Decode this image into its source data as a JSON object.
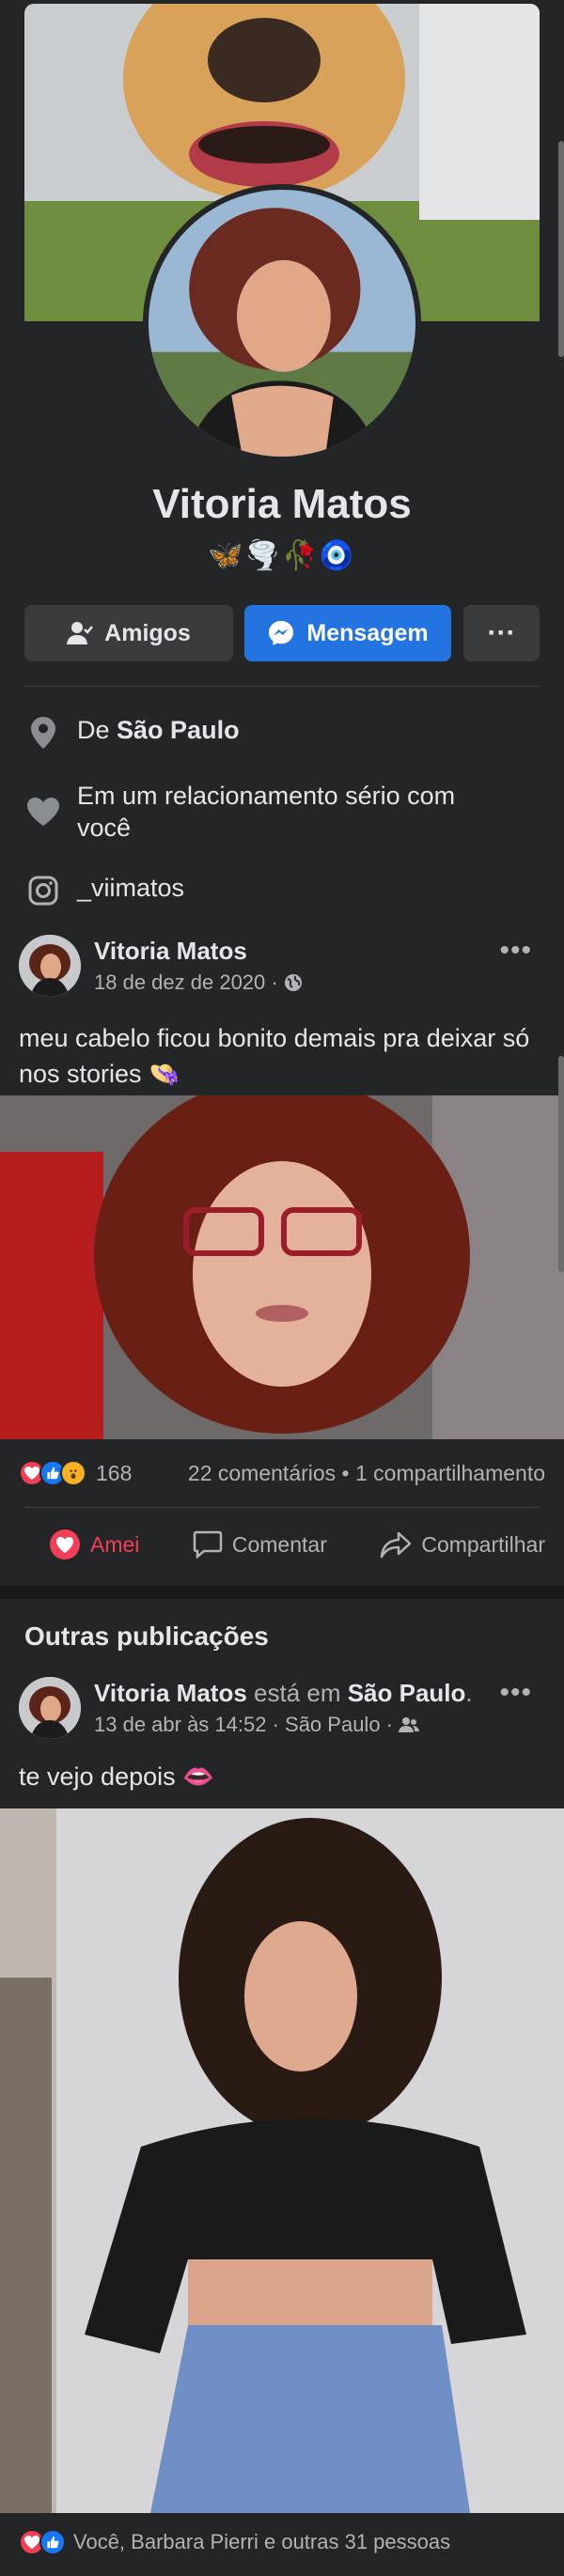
{
  "profile": {
    "name": "Vitoria Matos",
    "bio": "🦋🌪️🥀🧿"
  },
  "actions": {
    "friends_label": "Amigos",
    "message_label": "Mensagem",
    "more_label": "···"
  },
  "intro": {
    "from_prefix": "De ",
    "from_city": "São Paulo",
    "relationship": "Em um relacionamento sério com você",
    "instagram": "_viimatos"
  },
  "post1": {
    "author": "Vitoria Matos",
    "date": "18 de dez de 2020 · ",
    "privacy_icon": "globe-icon",
    "text": "meu cabelo ficou bonito demais pra deixar só nos stories 👒",
    "reaction_count": "168",
    "comments_shares": "22 comentários • 1 compartilhamento",
    "love_label": "Amei",
    "comment_label": "Comentar",
    "share_label": "Compartilhar"
  },
  "others": {
    "title": "Outras publicações"
  },
  "post2": {
    "author": "Vitoria Matos",
    "at_text": " está em ",
    "place": "São Paulo",
    "place_dot": ".",
    "date": "13 de abr às 14:52 · São Paulo · ",
    "privacy_icon": "friends-icon",
    "text": "te vejo depois 👄",
    "reactions_summary": "Você, Barbara Pierri e outras 31 pessoas"
  },
  "colors": {
    "background": "#242526",
    "primary_blue": "#2374e1",
    "love_red": "#f33e58",
    "secondary_text": "#b0b3b8"
  }
}
